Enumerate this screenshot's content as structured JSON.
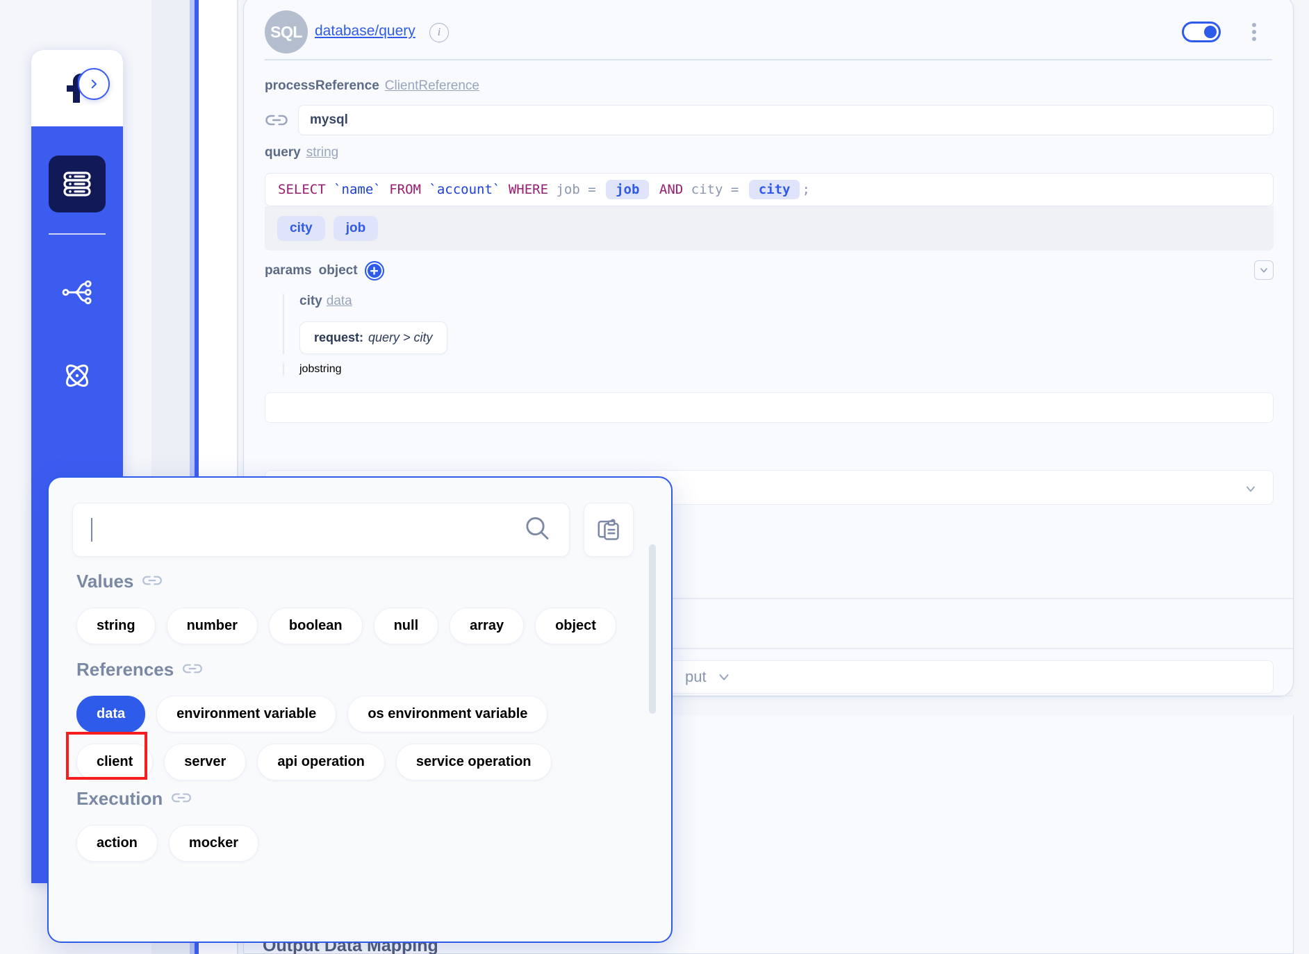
{
  "sidebar": {
    "logo_alt": "app-logo",
    "expand_label": "›",
    "items": [
      {
        "id": "database",
        "icon": "database-icon",
        "active": true
      },
      {
        "id": "flow",
        "icon": "flow-icon",
        "active": false
      },
      {
        "id": "atom",
        "icon": "atom-icon",
        "active": false
      }
    ]
  },
  "node": {
    "avatar_text": "SQL",
    "title": "database/query",
    "info_icon": "i",
    "toggle_on": true,
    "fields": {
      "process_reference_label": "processReference",
      "process_reference_type": "ClientReference",
      "process_reference_value": "mysql",
      "query_label": "query",
      "query_type": "string",
      "sql": {
        "tokens": [
          {
            "t": "SELECT",
            "k": "kw"
          },
          {
            "t": " ",
            "k": "sp"
          },
          {
            "t": "`name`",
            "k": "tick"
          },
          {
            "t": " ",
            "k": "sp"
          },
          {
            "t": "FROM",
            "k": "kw"
          },
          {
            "t": " ",
            "k": "sp"
          },
          {
            "t": "`account`",
            "k": "tick"
          },
          {
            "t": " ",
            "k": "sp"
          },
          {
            "t": "WHERE",
            "k": "kw"
          },
          {
            "t": " job = ",
            "k": "id"
          },
          {
            "t": "job",
            "k": "chip"
          },
          {
            "t": " ",
            "k": "sp"
          },
          {
            "t": "AND",
            "k": "kw"
          },
          {
            "t": " city = ",
            "k": "id"
          },
          {
            "t": "city",
            "k": "chip"
          },
          {
            "t": ";",
            "k": "id"
          }
        ],
        "raw": "SELECT `name` FROM `account` WHERE job = job AND city = city ;"
      },
      "variable_chips": [
        "city",
        "job"
      ],
      "params_label": "params",
      "params_type": "object",
      "params_add": "+",
      "sub_params": [
        {
          "name": "city",
          "type": "data",
          "mapping_label": "request:",
          "mapping_value": "query > city"
        },
        {
          "name": "job",
          "type": "string"
        }
      ],
      "output_label": "put"
    }
  },
  "bottom": {
    "title": "Output Data Mapping"
  },
  "popup": {
    "search_value": "",
    "search_placeholder": "",
    "search_icon": "search-icon",
    "paste_icon": "clipboard-paste-icon",
    "sections": [
      {
        "id": "values",
        "title": "Values",
        "link_icon": "link-icon",
        "chips": [
          {
            "label": "string",
            "active": false
          },
          {
            "label": "number",
            "active": false
          },
          {
            "label": "boolean",
            "active": false
          },
          {
            "label": "null",
            "active": false
          },
          {
            "label": "array",
            "active": false
          },
          {
            "label": "object",
            "active": false
          }
        ]
      },
      {
        "id": "references",
        "title": "References",
        "link_icon": "link-icon",
        "chips": [
          {
            "label": "data",
            "active": true
          },
          {
            "label": "environment variable",
            "active": false
          },
          {
            "label": "os environment variable",
            "active": false
          },
          {
            "label": "client",
            "active": false
          },
          {
            "label": "server",
            "active": false
          },
          {
            "label": "api operation",
            "active": false
          },
          {
            "label": "service operation",
            "active": false
          }
        ]
      },
      {
        "id": "execution",
        "title": "Execution",
        "link_icon": "link-icon",
        "chips": [
          {
            "label": "action",
            "active": false
          },
          {
            "label": "mocker",
            "active": false
          }
        ]
      }
    ]
  },
  "colors": {
    "accent": "#2f5bea",
    "sidebar": "#3c5cf0",
    "sidebar_active": "#111a56",
    "annotation": "#f51d1d",
    "chip_bg": "#dfe4fb",
    "keyword": "#9b1d72",
    "identifier": "#1b3fd8",
    "muted": "#8b97ae"
  }
}
